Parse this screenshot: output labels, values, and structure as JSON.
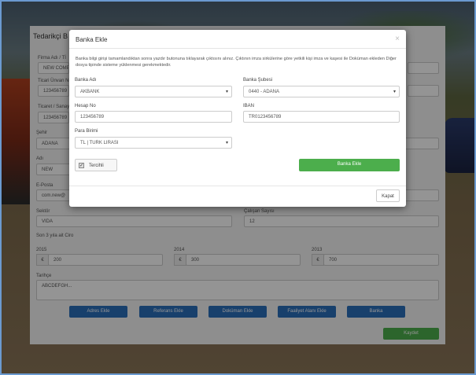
{
  "background_form": {
    "title": "Tedarikçi B",
    "firma_adi_label": "Firma Adı / Tİ",
    "firma_adi_value": "NEW COMP",
    "ticari_unvan_label": "Ticari Ünvan No",
    "ticari_unvan_value": "123456789",
    "ticaret_sicil_label": "Ticaret / Sanayi",
    "ticaret_sicil_value": "123456789",
    "sehir_label": "Şehir",
    "sehir_value": "ADANA",
    "adi_label": "Adı",
    "adi_value": "NEW",
    "eposta_label": "E-Posta",
    "eposta_value": "com.new@",
    "sektor_label": "Sektör",
    "sektor_value": "VIDA",
    "calisan_label": "Çalışan Sayısı",
    "calisan_value": "12",
    "ciro_label": "Son 3 yıla ait Ciro",
    "years": [
      {
        "year": "2015",
        "currency": "€",
        "amount": "200"
      },
      {
        "year": "2014",
        "currency": "€",
        "amount": "300"
      },
      {
        "year": "2013",
        "currency": "€",
        "amount": "700"
      }
    ],
    "tarihce_label": "Tarihçe",
    "tarihce_value": "ABCDEFGH...",
    "buttons": {
      "adres_ekle": "Adres Ekle",
      "referans_ekle": "Referans Ekle",
      "dokuman_ekle": "Doküman Ekle",
      "faaliyet_alani_ekle": "Faaliyet Alanı Ekle",
      "banka": "Banka",
      "kaydet": "Kaydet"
    }
  },
  "modal": {
    "title": "Banka Ekle",
    "close_symbol": "×",
    "info_text": "Banka bilgi girişi tamamlandıktan sonra yazdır butonuna tıklayarak çıktısını alınız. Çıktının imza sirkülerine göre yetkili kişi imza ve kaşesi ile Doküman ekleden Diğer dosya tipinde sisteme yüklenmesi gerekmektedir.",
    "fields": {
      "banka_adi": {
        "label": "Banka Adı",
        "value": "AKBANK"
      },
      "banka_subesi": {
        "label": "Banka Şubesi",
        "value": "0440 - ADANA"
      },
      "hesap_no": {
        "label": "Hesap No",
        "value": "123456789"
      },
      "iban": {
        "label": "IBAN",
        "value": "TR0123456789"
      },
      "para_birimi": {
        "label": "Para Birimi",
        "value": "TL | TURK LIRASI"
      }
    },
    "tercihli_label": "Tercihli",
    "tercihli_checked": true,
    "check_symbol": "✓",
    "caret_symbol": "▾",
    "submit_label": "Banka Ekle",
    "close_label": "Kapat"
  },
  "colors": {
    "primary_blue": "#2a6ebb",
    "success_green": "#4cae4c"
  }
}
